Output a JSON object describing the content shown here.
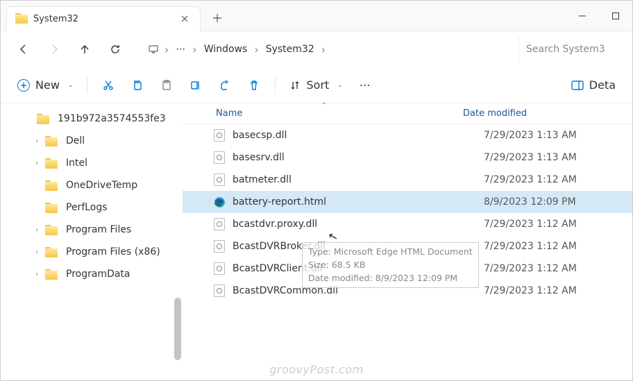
{
  "tab": {
    "title": "System32"
  },
  "breadcrumbs": {
    "items": [
      "Windows",
      "System32"
    ]
  },
  "search": {
    "placeholder": "Search System3"
  },
  "toolbar": {
    "new_label": "New",
    "sort_label": "Sort",
    "details_label": "Deta"
  },
  "sidebar": {
    "items": [
      {
        "name": "191b972a3574553fe3",
        "expandable": false
      },
      {
        "name": "Dell",
        "expandable": true
      },
      {
        "name": "Intel",
        "expandable": true
      },
      {
        "name": "OneDriveTemp",
        "expandable": false
      },
      {
        "name": "PerfLogs",
        "expandable": false
      },
      {
        "name": "Program Files",
        "expandable": true
      },
      {
        "name": "Program Files (x86)",
        "expandable": true
      },
      {
        "name": "ProgramData",
        "expandable": true
      }
    ]
  },
  "columns": {
    "name": "Name",
    "date": "Date modified"
  },
  "files": [
    {
      "name": "basecsp.dll",
      "date": "7/29/2023 1:13 AM",
      "type": "dll"
    },
    {
      "name": "basesrv.dll",
      "date": "7/29/2023 1:13 AM",
      "type": "dll"
    },
    {
      "name": "batmeter.dll",
      "date": "7/29/2023 1:12 AM",
      "type": "dll"
    },
    {
      "name": "battery-report.html",
      "date": "8/9/2023 12:09 PM",
      "type": "html",
      "selected": true
    },
    {
      "name": "bcastdvr.proxy.dll",
      "date": "7/29/2023 1:12 AM",
      "type": "dll"
    },
    {
      "name": "BcastDVRBroker.dll",
      "date": "7/29/2023 1:12 AM",
      "type": "dll"
    },
    {
      "name": "BcastDVRClient.dll",
      "date": "7/29/2023 1:12 AM",
      "type": "dll"
    },
    {
      "name": "BcastDVRCommon.dll",
      "date": "7/29/2023 1:12 AM",
      "type": "dll"
    }
  ],
  "tooltip": {
    "line1": "Type: Microsoft Edge HTML Document",
    "line2": "Size: 68.5 KB",
    "line3": "Date modified: 8/9/2023 12:09 PM"
  },
  "watermark": "groovyPost.com"
}
